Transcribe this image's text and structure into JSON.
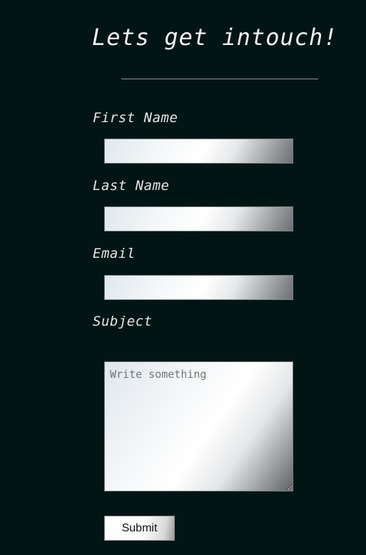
{
  "form": {
    "title": "Lets get intouch!",
    "fields": {
      "first_name": {
        "label": "First Name",
        "value": "",
        "placeholder": ""
      },
      "last_name": {
        "label": "Last Name",
        "value": "",
        "placeholder": ""
      },
      "email": {
        "label": "Email",
        "value": "",
        "placeholder": ""
      },
      "subject": {
        "label": "Subject",
        "value": "",
        "placeholder": "Write something"
      }
    },
    "submit_label": "Submit"
  }
}
